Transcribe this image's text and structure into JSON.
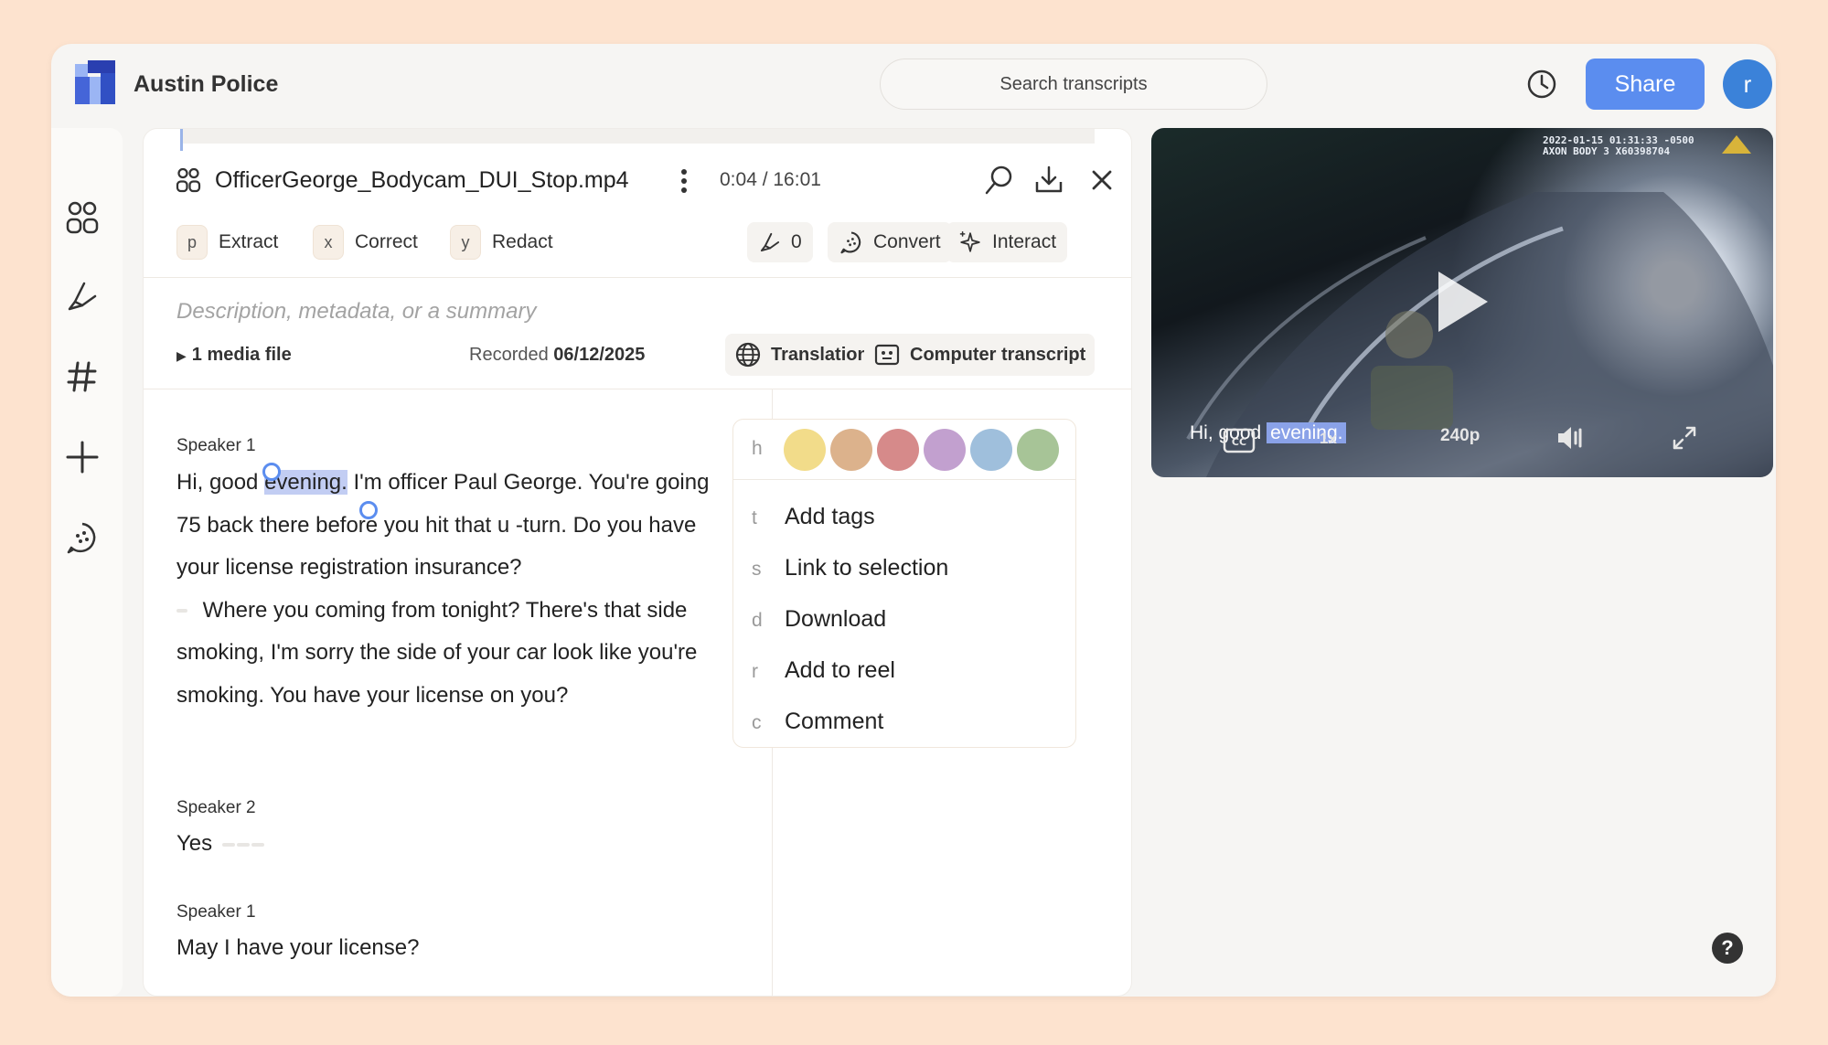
{
  "app": {
    "title": "Austin Police"
  },
  "search": {
    "placeholder": "Search transcripts"
  },
  "header": {
    "share_label": "Share",
    "avatar_initial": "r"
  },
  "file": {
    "name": "OfficerGeorge_Bodycam_DUI_Stop.mp4",
    "time": "0:04 / 16:01"
  },
  "actions": [
    {
      "key": "p",
      "label": "Extract"
    },
    {
      "key": "x",
      "label": "Correct"
    },
    {
      "key": "y",
      "label": "Redact"
    }
  ],
  "tools": {
    "count": "0",
    "convert": "Convert",
    "interact": "Interact"
  },
  "details": {
    "description_placeholder": "Description, metadata, or a summary",
    "media_files": "1 media file",
    "recorded_label": "Recorded",
    "recorded_date": "06/12/2025",
    "translations": "Translations",
    "computer_transcript": "Computer transcript"
  },
  "transcript": [
    {
      "speaker": "Speaker 1",
      "text_pre": "Hi, good ",
      "text_hl": "evening.",
      "text_post": " I'm officer Paul George. You're going 75 back there before you hit that u -turn. Do you have your license registration insurance?",
      "text_post2": " Where you coming from tonight? There's that side smoking, I'm sorry the side of your car look like you're smoking. You have your license on you?"
    },
    {
      "speaker": "Speaker 2",
      "text": "Yes"
    },
    {
      "speaker": "Speaker 1",
      "text": "May I have your license?"
    }
  ],
  "context_menu": {
    "color_key": "h",
    "colors": [
      "#f2dc8a",
      "#dcb28c",
      "#d68a8a",
      "#c2a0cf",
      "#9fbfdc",
      "#a7c497"
    ],
    "items": [
      {
        "key": "t",
        "label": "Add tags"
      },
      {
        "key": "s",
        "label": "Link to selection"
      },
      {
        "key": "d",
        "label": "Download"
      },
      {
        "key": "r",
        "label": "Add to reel"
      },
      {
        "key": "c",
        "label": "Comment"
      }
    ]
  },
  "video": {
    "timestamp_line1": "2022-01-15 01:31:33 -0500",
    "timestamp_line2": "AXON BODY 3 X60398704",
    "caption_pre": "Hi, good ",
    "caption_hl": "evening.",
    "quality": "240p",
    "speed": "1x"
  },
  "help_label": "?"
}
